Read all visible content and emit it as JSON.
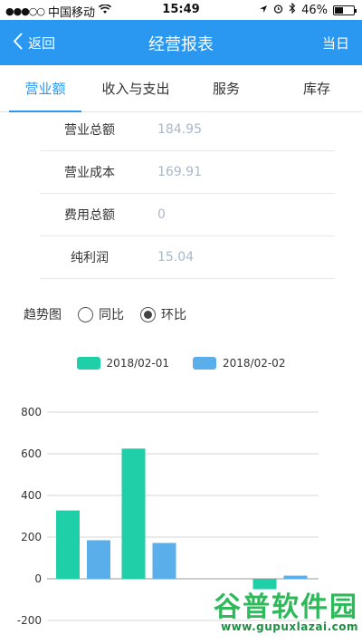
{
  "status_bar": {
    "carrier": "中国移动",
    "time": "15:49",
    "battery": "46%"
  },
  "nav": {
    "back_label": "返回",
    "title": "经营报表",
    "right_label": "当日"
  },
  "tabs": [
    {
      "label": "营业额",
      "active": true
    },
    {
      "label": "收入与支出",
      "active": false
    },
    {
      "label": "服务",
      "active": false
    },
    {
      "label": "库存",
      "active": false
    }
  ],
  "summary": [
    {
      "label": "营业总额",
      "value": "184.95"
    },
    {
      "label": "营业成本",
      "value": "169.91"
    },
    {
      "label": "费用总额",
      "value": "0"
    },
    {
      "label": "纯利润",
      "value": "15.04"
    }
  ],
  "trend": {
    "label": "趋势图",
    "options": [
      {
        "label": "同比",
        "checked": false
      },
      {
        "label": "环比",
        "checked": true
      }
    ]
  },
  "chart_data": {
    "type": "bar",
    "ylim": [
      -200,
      800
    ],
    "yticks": [
      800,
      600,
      400,
      200,
      0,
      -200
    ],
    "categories": [
      "",
      "",
      "",
      ""
    ],
    "series": [
      {
        "name": "2018/02-01",
        "color": "#1fcfa8",
        "values": [
          328,
          625,
          0,
          -50
        ]
      },
      {
        "name": "2018/02-02",
        "color": "#5aaeea",
        "values": [
          185,
          172,
          0,
          15
        ]
      }
    ]
  },
  "watermark": {
    "title": "谷普软件园",
    "url": "www.gupuxlazai.com"
  }
}
